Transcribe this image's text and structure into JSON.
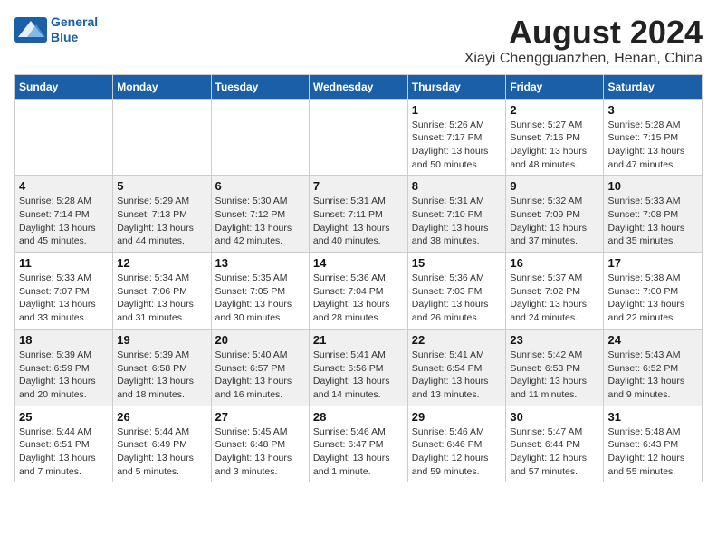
{
  "header": {
    "logo_line1": "General",
    "logo_line2": "Blue",
    "month_year": "August 2024",
    "location": "Xiayi Chengguanzhen, Henan, China"
  },
  "weekdays": [
    "Sunday",
    "Monday",
    "Tuesday",
    "Wednesday",
    "Thursday",
    "Friday",
    "Saturday"
  ],
  "rows": [
    [
      {
        "day": "",
        "info": ""
      },
      {
        "day": "",
        "info": ""
      },
      {
        "day": "",
        "info": ""
      },
      {
        "day": "",
        "info": ""
      },
      {
        "day": "1",
        "info": "Sunrise: 5:26 AM\nSunset: 7:17 PM\nDaylight: 13 hours\nand 50 minutes."
      },
      {
        "day": "2",
        "info": "Sunrise: 5:27 AM\nSunset: 7:16 PM\nDaylight: 13 hours\nand 48 minutes."
      },
      {
        "day": "3",
        "info": "Sunrise: 5:28 AM\nSunset: 7:15 PM\nDaylight: 13 hours\nand 47 minutes."
      }
    ],
    [
      {
        "day": "4",
        "info": "Sunrise: 5:28 AM\nSunset: 7:14 PM\nDaylight: 13 hours\nand 45 minutes."
      },
      {
        "day": "5",
        "info": "Sunrise: 5:29 AM\nSunset: 7:13 PM\nDaylight: 13 hours\nand 44 minutes."
      },
      {
        "day": "6",
        "info": "Sunrise: 5:30 AM\nSunset: 7:12 PM\nDaylight: 13 hours\nand 42 minutes."
      },
      {
        "day": "7",
        "info": "Sunrise: 5:31 AM\nSunset: 7:11 PM\nDaylight: 13 hours\nand 40 minutes."
      },
      {
        "day": "8",
        "info": "Sunrise: 5:31 AM\nSunset: 7:10 PM\nDaylight: 13 hours\nand 38 minutes."
      },
      {
        "day": "9",
        "info": "Sunrise: 5:32 AM\nSunset: 7:09 PM\nDaylight: 13 hours\nand 37 minutes."
      },
      {
        "day": "10",
        "info": "Sunrise: 5:33 AM\nSunset: 7:08 PM\nDaylight: 13 hours\nand 35 minutes."
      }
    ],
    [
      {
        "day": "11",
        "info": "Sunrise: 5:33 AM\nSunset: 7:07 PM\nDaylight: 13 hours\nand 33 minutes."
      },
      {
        "day": "12",
        "info": "Sunrise: 5:34 AM\nSunset: 7:06 PM\nDaylight: 13 hours\nand 31 minutes."
      },
      {
        "day": "13",
        "info": "Sunrise: 5:35 AM\nSunset: 7:05 PM\nDaylight: 13 hours\nand 30 minutes."
      },
      {
        "day": "14",
        "info": "Sunrise: 5:36 AM\nSunset: 7:04 PM\nDaylight: 13 hours\nand 28 minutes."
      },
      {
        "day": "15",
        "info": "Sunrise: 5:36 AM\nSunset: 7:03 PM\nDaylight: 13 hours\nand 26 minutes."
      },
      {
        "day": "16",
        "info": "Sunrise: 5:37 AM\nSunset: 7:02 PM\nDaylight: 13 hours\nand 24 minutes."
      },
      {
        "day": "17",
        "info": "Sunrise: 5:38 AM\nSunset: 7:00 PM\nDaylight: 13 hours\nand 22 minutes."
      }
    ],
    [
      {
        "day": "18",
        "info": "Sunrise: 5:39 AM\nSunset: 6:59 PM\nDaylight: 13 hours\nand 20 minutes."
      },
      {
        "day": "19",
        "info": "Sunrise: 5:39 AM\nSunset: 6:58 PM\nDaylight: 13 hours\nand 18 minutes."
      },
      {
        "day": "20",
        "info": "Sunrise: 5:40 AM\nSunset: 6:57 PM\nDaylight: 13 hours\nand 16 minutes."
      },
      {
        "day": "21",
        "info": "Sunrise: 5:41 AM\nSunset: 6:56 PM\nDaylight: 13 hours\nand 14 minutes."
      },
      {
        "day": "22",
        "info": "Sunrise: 5:41 AM\nSunset: 6:54 PM\nDaylight: 13 hours\nand 13 minutes."
      },
      {
        "day": "23",
        "info": "Sunrise: 5:42 AM\nSunset: 6:53 PM\nDaylight: 13 hours\nand 11 minutes."
      },
      {
        "day": "24",
        "info": "Sunrise: 5:43 AM\nSunset: 6:52 PM\nDaylight: 13 hours\nand 9 minutes."
      }
    ],
    [
      {
        "day": "25",
        "info": "Sunrise: 5:44 AM\nSunset: 6:51 PM\nDaylight: 13 hours\nand 7 minutes."
      },
      {
        "day": "26",
        "info": "Sunrise: 5:44 AM\nSunset: 6:49 PM\nDaylight: 13 hours\nand 5 minutes."
      },
      {
        "day": "27",
        "info": "Sunrise: 5:45 AM\nSunset: 6:48 PM\nDaylight: 13 hours\nand 3 minutes."
      },
      {
        "day": "28",
        "info": "Sunrise: 5:46 AM\nSunset: 6:47 PM\nDaylight: 13 hours\nand 1 minute."
      },
      {
        "day": "29",
        "info": "Sunrise: 5:46 AM\nSunset: 6:46 PM\nDaylight: 12 hours\nand 59 minutes."
      },
      {
        "day": "30",
        "info": "Sunrise: 5:47 AM\nSunset: 6:44 PM\nDaylight: 12 hours\nand 57 minutes."
      },
      {
        "day": "31",
        "info": "Sunrise: 5:48 AM\nSunset: 6:43 PM\nDaylight: 12 hours\nand 55 minutes."
      }
    ]
  ],
  "row_bg": [
    "#ffffff",
    "#f0f0f0",
    "#ffffff",
    "#f0f0f0",
    "#f0f0f0"
  ]
}
